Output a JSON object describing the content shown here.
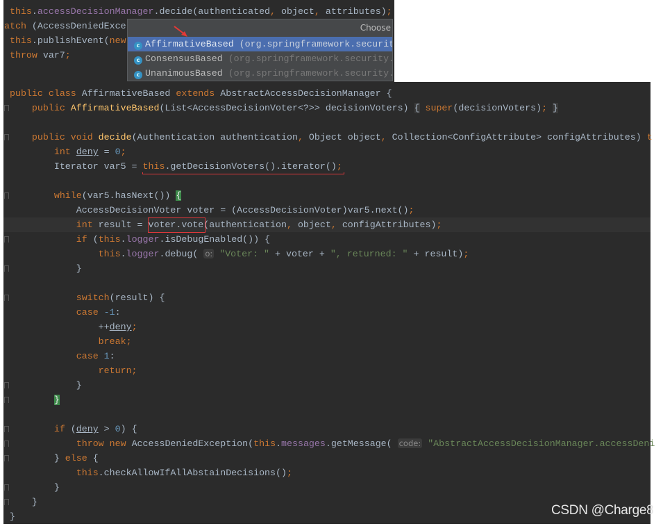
{
  "colors": {
    "keyword": "#cc7832",
    "field": "#9876aa",
    "method_decl": "#ffc66d",
    "string": "#6a8759",
    "number": "#6897bb",
    "text": "#a9b7c6",
    "background": "#2b2b2b",
    "selection": "#4b6eaf",
    "annotation": "#e0383b"
  },
  "snippet": {
    "lines": [
      [
        [
          " ",
          ""
        ],
        [
          "this",
          "k"
        ],
        [
          ".",
          ""
        ],
        [
          "accessDecisionManager",
          "f"
        ],
        [
          ".decide(authenticated",
          ""
        ],
        [
          ", ",
          "k"
        ],
        [
          "object",
          ""
        ],
        [
          ", ",
          "k"
        ],
        [
          "attributes)",
          ""
        ],
        [
          ";",
          "k"
        ]
      ],
      [
        [
          "atch",
          "k"
        ],
        [
          " (AccessDeniedExce",
          ""
        ]
      ],
      [
        [
          " ",
          ""
        ],
        [
          "this",
          "k"
        ],
        [
          ".publishEvent(",
          ""
        ],
        [
          "new",
          "k"
        ]
      ],
      [
        [
          " ",
          ""
        ],
        [
          "throw",
          "k"
        ],
        [
          " var7",
          ""
        ],
        [
          ";",
          "k"
        ]
      ]
    ]
  },
  "popup": {
    "header": "Choose",
    "items": [
      {
        "icon": "class-icon",
        "icon_letter": "c",
        "name": "AffirmativeBased",
        "package": " (org.springframework.security",
        "selected": true
      },
      {
        "icon": "class-icon",
        "icon_letter": "c",
        "name": "ConsensusBased",
        "package": " (org.springframework.security.",
        "selected": false
      },
      {
        "icon": "class-icon",
        "icon_letter": "c",
        "name": "UnanimousBased",
        "package": " (org.springframework.security.",
        "selected": false
      }
    ]
  },
  "editor": {
    "lines": [
      [
        [
          "public class ",
          "k"
        ],
        [
          "AffirmativeBased ",
          ""
        ],
        [
          "extends ",
          "k"
        ],
        [
          "AbstractAccessDecisionManager {",
          ""
        ]
      ],
      [
        [
          "    public ",
          "k"
        ],
        [
          "AffirmativeBased",
          "m"
        ],
        [
          "(List<AccessDecisionVoter<?>> decisionVoters) ",
          ""
        ],
        [
          "{",
          "b"
        ],
        [
          " ",
          ""
        ],
        [
          "super",
          "k"
        ],
        [
          "(decisionVoters)",
          ""
        ],
        [
          ";",
          "k"
        ],
        [
          " ",
          ""
        ],
        [
          "}",
          "b"
        ]
      ],
      [],
      [
        [
          "    public void ",
          "k"
        ],
        [
          "decide",
          "m"
        ],
        [
          "(Authentication authentication",
          ""
        ],
        [
          ", ",
          "k"
        ],
        [
          "Object object",
          ""
        ],
        [
          ", ",
          "k"
        ],
        [
          "Collection<ConfigAttribute> configAttributes) ",
          ""
        ],
        [
          "t",
          "k"
        ]
      ],
      [
        [
          "        int ",
          "k"
        ],
        [
          "deny",
          "u"
        ],
        [
          " = ",
          ""
        ],
        [
          "0",
          "n"
        ],
        [
          ";",
          "k"
        ]
      ],
      [
        [
          "        Iterator var5 = ",
          ""
        ],
        [
          "this",
          "k"
        ],
        [
          ".getDecisionVoters().iterator()",
          ""
        ],
        [
          ";",
          "k"
        ]
      ],
      [],
      [
        [
          "        while",
          "k"
        ],
        [
          "(var5.hasNext()) ",
          ""
        ],
        [
          "{",
          "g"
        ]
      ],
      [
        [
          "            AccessDecisionVoter voter = (AccessDecisionVoter)var5.next()",
          ""
        ],
        [
          ";",
          "k"
        ]
      ],
      [
        [
          "            int ",
          "k"
        ],
        [
          "result = voter.vote(authentication",
          ""
        ],
        [
          ", ",
          "k"
        ],
        [
          "object",
          ""
        ],
        [
          ", ",
          "k"
        ],
        [
          "configAttributes)",
          ""
        ],
        [
          ";",
          "k"
        ]
      ],
      [
        [
          "            if ",
          "k"
        ],
        [
          "(",
          ""
        ],
        [
          "this",
          "k"
        ],
        [
          ".",
          ""
        ],
        [
          "logger",
          "f"
        ],
        [
          ".isDebugEnabled()) {",
          ""
        ]
      ],
      [
        [
          "                this",
          "k"
        ],
        [
          ".",
          ""
        ],
        [
          "logger",
          "f"
        ],
        [
          ".debug( ",
          ""
        ],
        [
          "o:",
          "h"
        ],
        [
          " ",
          ""
        ],
        [
          "\"Voter: \"",
          "s"
        ],
        [
          " + voter + ",
          ""
        ],
        [
          "\", returned: \"",
          "s"
        ],
        [
          " + result)",
          ""
        ],
        [
          ";",
          "k"
        ]
      ],
      [
        [
          "            }",
          ""
        ]
      ],
      [],
      [
        [
          "            switch",
          "k"
        ],
        [
          "(result) {",
          ""
        ]
      ],
      [
        [
          "            case ",
          "k"
        ],
        [
          "-1",
          "n"
        ],
        [
          ":",
          ""
        ]
      ],
      [
        [
          "                ++",
          ""
        ],
        [
          "deny",
          "u"
        ],
        [
          ";",
          "k"
        ]
      ],
      [
        [
          "                break;",
          "k"
        ]
      ],
      [
        [
          "            case ",
          "k"
        ],
        [
          "1",
          "n"
        ],
        [
          ":",
          ""
        ]
      ],
      [
        [
          "                return;",
          "k"
        ]
      ],
      [
        [
          "            }",
          ""
        ]
      ],
      [
        [
          "        ",
          ""
        ],
        [
          "}",
          "g"
        ]
      ],
      [],
      [
        [
          "        if ",
          "k"
        ],
        [
          "(",
          ""
        ],
        [
          "deny",
          "u"
        ],
        [
          " > ",
          ""
        ],
        [
          "0",
          "n"
        ],
        [
          ") {",
          ""
        ]
      ],
      [
        [
          "            throw new ",
          "k"
        ],
        [
          "AccessDeniedException(",
          ""
        ],
        [
          "this",
          "k"
        ],
        [
          ".",
          ""
        ],
        [
          "messages",
          "f"
        ],
        [
          ".getMessage( ",
          ""
        ],
        [
          "code:",
          "h"
        ],
        [
          " ",
          ""
        ],
        [
          "\"AbstractAccessDecisionManager.accessDeni",
          "s"
        ]
      ],
      [
        [
          "        } ",
          ""
        ],
        [
          "else ",
          "k"
        ],
        [
          "{",
          ""
        ]
      ],
      [
        [
          "            this",
          "k"
        ],
        [
          ".checkAllowIfAllAbstainDecisions()",
          ""
        ],
        [
          ";",
          "k"
        ]
      ],
      [
        [
          "        }",
          ""
        ]
      ],
      [
        [
          "    }",
          ""
        ]
      ],
      [
        [
          "}",
          ""
        ]
      ]
    ]
  },
  "watermark": "CSDN @Charge8"
}
